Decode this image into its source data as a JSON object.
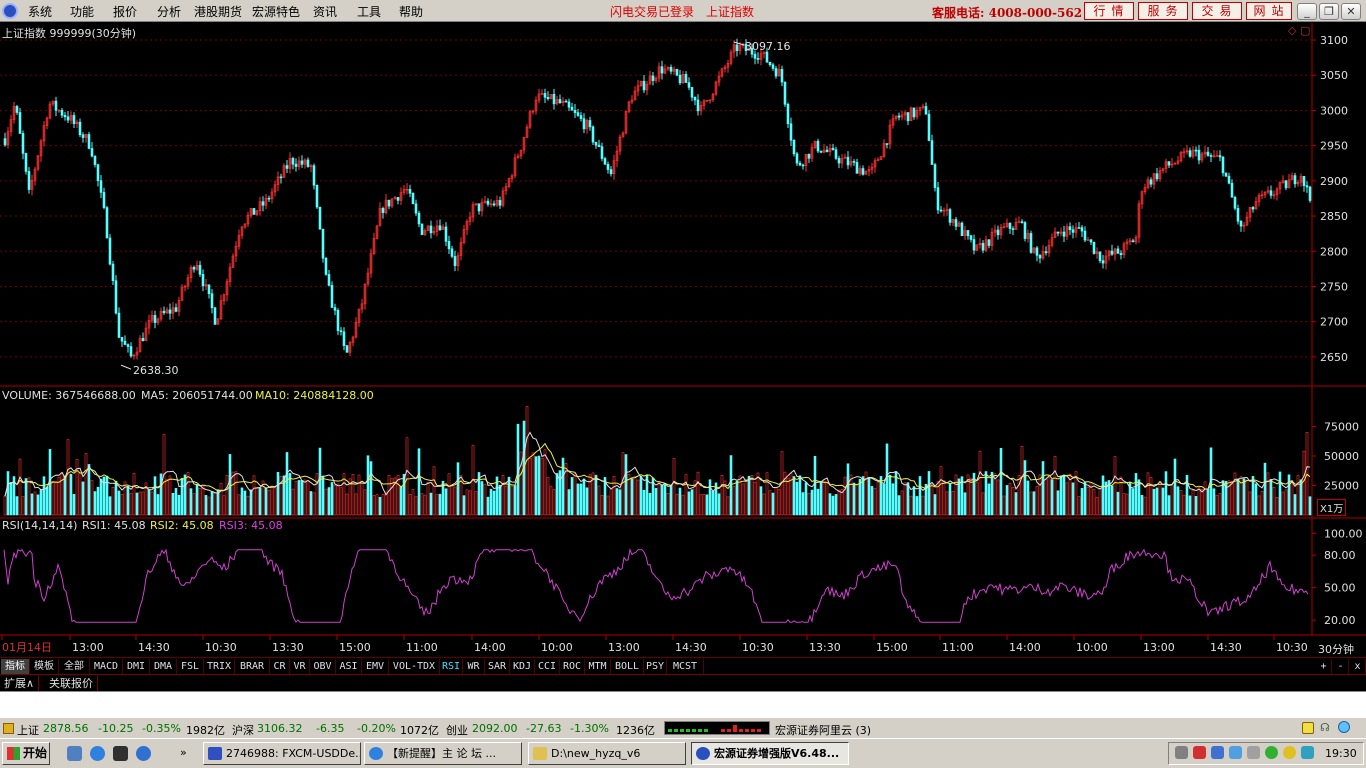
{
  "window": {
    "menu": [
      "系统",
      "功能",
      "报价",
      "分析",
      "港股期货",
      "宏源特色",
      "资讯",
      "工具",
      "帮助"
    ],
    "status_flash": "闪电交易已登录",
    "status_index": "上证指数",
    "phone": "客服电话: 4008-000-562",
    "nav_buttons": [
      "行情",
      "服务",
      "交易",
      "网站"
    ],
    "window_buttons": [
      "_",
      "❐",
      "✕"
    ]
  },
  "price_pane": {
    "title": "上证指数 999999(30分钟)",
    "y_ticks": [
      "3100",
      "3050",
      "3000",
      "2950",
      "2900",
      "2850",
      "2800",
      "2750",
      "2700",
      "2650"
    ],
    "y_range": [
      2620,
      3110
    ],
    "high_label": "3097.16",
    "low_label": "2638.30",
    "high_value": 3097.16,
    "low_value": 2638.3,
    "up_color": "#ff3232",
    "down_color": "#54ffff"
  },
  "volume_pane": {
    "label_vol": "VOLUME: 367546688.00",
    "label_ma5": "MA5: 206051744.00",
    "label_ma10": "MA10: 240884128.00",
    "y_ticks": [
      "75000",
      "50000",
      "25000"
    ],
    "unit": "X1万"
  },
  "rsi_pane": {
    "label_name": "RSI(14,14,14)",
    "label_rsi1": "RSI1: 45.08",
    "label_rsi2": "RSI2: 45.08",
    "label_rsi3": "RSI3: 45.08",
    "y_ticks": [
      "100.00",
      "80.00",
      "50.00",
      "20.00"
    ],
    "line_color": "#d040d0"
  },
  "time_axis": {
    "labels": [
      "01月14日",
      "13:00",
      "14:30",
      "10:30",
      "13:30",
      "15:00",
      "11:00",
      "14:00",
      "10:00",
      "13:00",
      "14:30",
      "10:30",
      "13:30",
      "15:00",
      "11:00",
      "14:00",
      "10:00",
      "13:00",
      "14:30",
      "10:30"
    ],
    "period": "30分钟"
  },
  "indicator_tabs": [
    "指标",
    "模板",
    "全部",
    "MACD",
    "DMI",
    "DMA",
    "FSL",
    "TRIX",
    "BRAR",
    "CR",
    "VR",
    "OBV",
    "ASI",
    "EMV",
    "VOL-TDX",
    "RSI",
    "WR",
    "SAR",
    "KDJ",
    "CCI",
    "ROC",
    "MTM",
    "BOLL",
    "PSY",
    "MCST"
  ],
  "indicator_active": "RSI",
  "tab_controls": [
    "+",
    "-",
    "x"
  ],
  "sub_tabs": [
    "扩展∧",
    "关联报价"
  ],
  "ticker": {
    "sh_name": "上证",
    "sh_price": "2878.56",
    "sh_chg": "-10.25",
    "sh_pct": "-0.35%",
    "sh_amt": "1982亿",
    "sz_name": "沪深",
    "sz_price": "3106.32",
    "sz_chg": "-6.35",
    "sz_pct": "-0.20%",
    "sz_amt": "1072亿",
    "cy_name": "创业",
    "cy_price": "2092.00",
    "cy_chg": "-27.63",
    "cy_pct": "-1.30%",
    "cy_amt": "1236亿",
    "server": "宏源证券阿里云 (3)"
  },
  "taskbar": {
    "start": "开始",
    "tasks": [
      "2746988: FXCM-USDDe...",
      "【新提醒】主 论 坛 ...",
      "D:\\new_hyzq_v6",
      "宏源证券增强版V6.48..."
    ],
    "clock": "19:30"
  }
}
